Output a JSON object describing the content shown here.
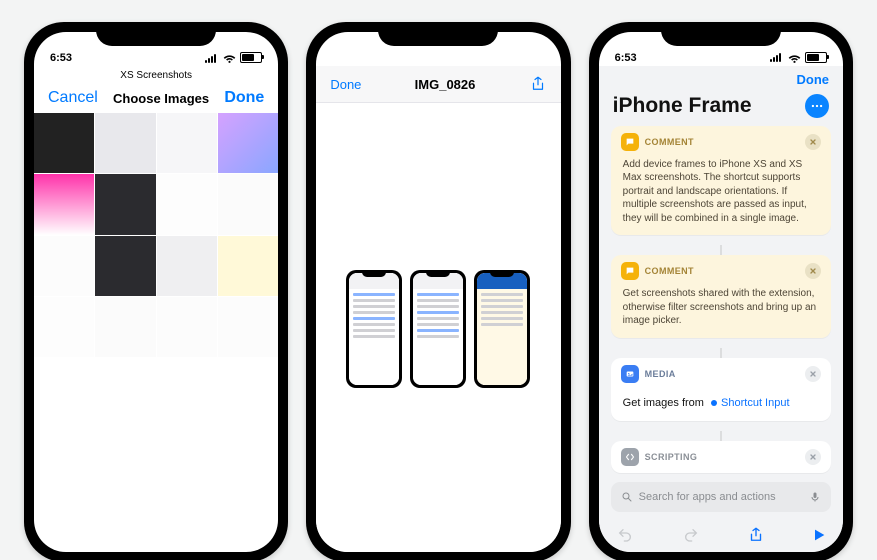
{
  "phone1": {
    "time": "6:53",
    "album_name": "XS Screenshots",
    "cancel": "Cancel",
    "title": "Choose Images",
    "done": "Done"
  },
  "phone2": {
    "done": "Done",
    "filename": "IMG_0826"
  },
  "phone3": {
    "time": "6:53",
    "done": "Done",
    "title": "iPhone Frame",
    "comment_label": "COMMENT",
    "media_label": "MEDIA",
    "scripting_label": "SCRIPTING",
    "comment1": "Add device frames to iPhone XS and XS Max screenshots. The shortcut supports portrait and landscape orientations. If multiple screenshots are passed as input, they will be combined in a single image.",
    "comment2": "Get screenshots shared with the extension, otherwise filter screenshots and bring up an image picker.",
    "action_prefix": "Get images from",
    "action_token": "Shortcut Input",
    "search_placeholder": "Search for apps and actions"
  }
}
